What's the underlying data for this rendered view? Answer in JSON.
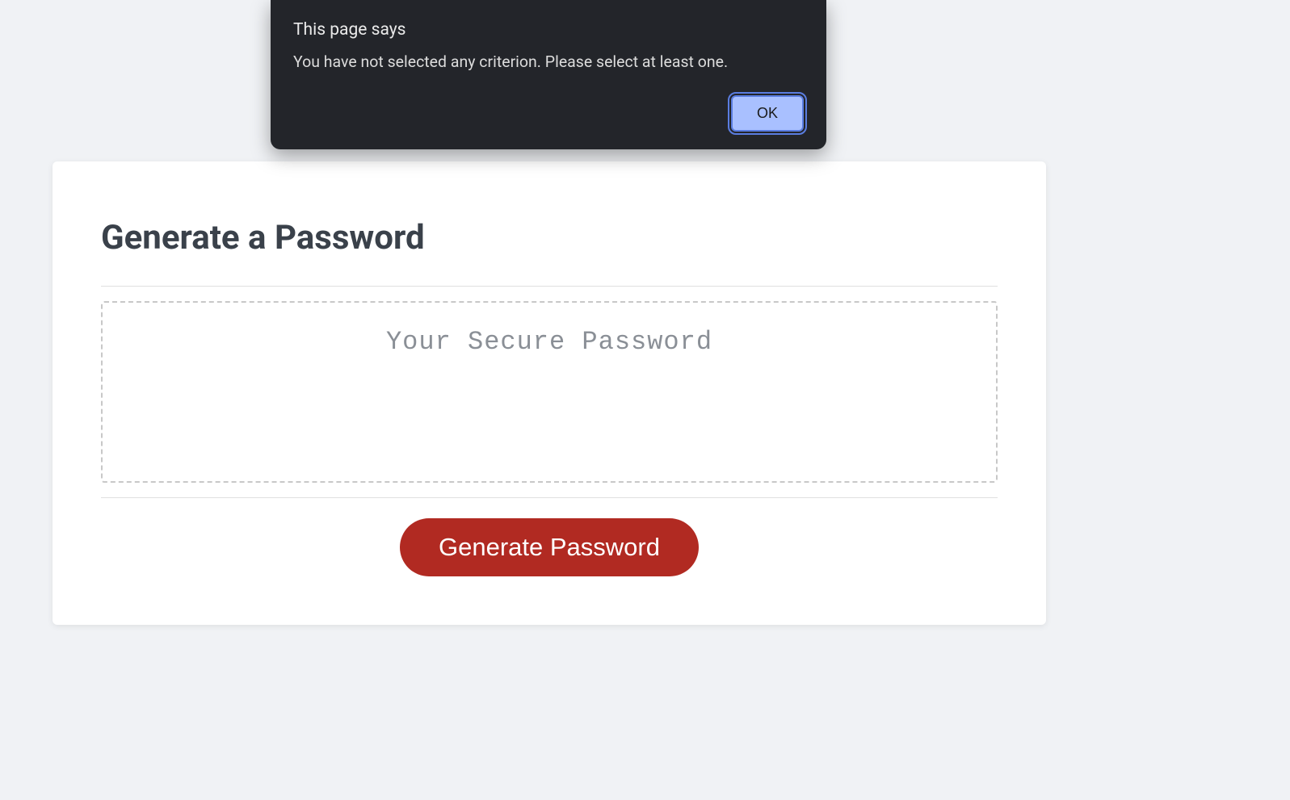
{
  "alert": {
    "title": "This page says",
    "message": "You have not selected any criterion. Please select at least one.",
    "ok_label": "OK"
  },
  "card": {
    "title": "Generate a Password",
    "password_placeholder": "Your Secure Password",
    "generate_button_label": "Generate Password"
  }
}
